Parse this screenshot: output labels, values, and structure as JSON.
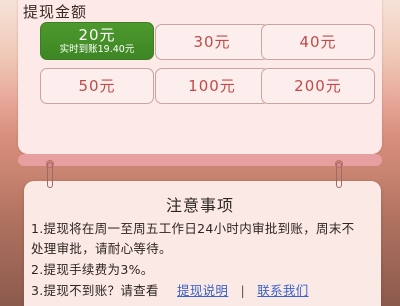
{
  "amount_section": {
    "title": "提现金额",
    "options": [
      {
        "label": "20元",
        "sub": "实时到账19.40元",
        "selected": true
      },
      {
        "label": "30元"
      },
      {
        "label": "40元"
      },
      {
        "label": "50元"
      },
      {
        "label": "100元"
      },
      {
        "label": "200元"
      }
    ]
  },
  "notice": {
    "title": "注意事项",
    "line1": "1.提现将在周一至周五工作日24小时内审批到账，周末不",
    "line2": "处理审批，请耐心等待。",
    "line3": "2.提现手续费为3%。",
    "line4_prefix": "3.提现不到账？请查看",
    "link_rules": "提现说明",
    "separator": "|",
    "link_contact": "联系我们"
  },
  "colors": {
    "selected_green": "#3d8624",
    "amount_red": "#c34a47",
    "link_blue": "#3b63c9"
  }
}
